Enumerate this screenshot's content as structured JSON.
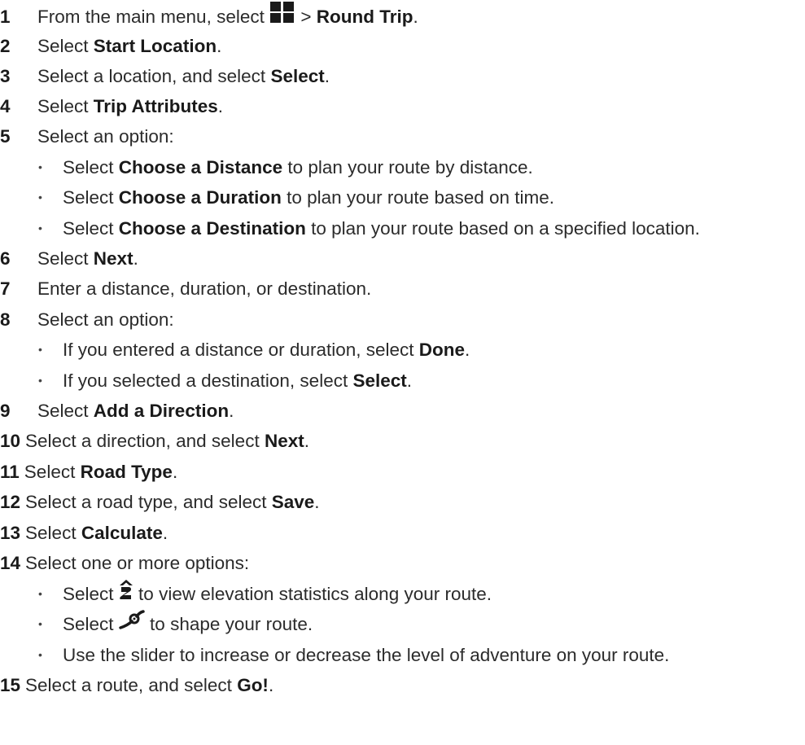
{
  "steps": [
    {
      "num": "1",
      "pre": "From the main menu, select",
      "mid": " > ",
      "bold": "Round Trip",
      "post": ".",
      "icon": "apps-grid-icon"
    },
    {
      "num": "2",
      "pre": "Select ",
      "bold": "Start Location",
      "post": "."
    },
    {
      "num": "3",
      "pre": "Select a location, and select ",
      "bold": "Select",
      "post": "."
    },
    {
      "num": "4",
      "pre": "Select ",
      "bold": "Trip Attributes",
      "post": "."
    },
    {
      "num": "5",
      "text": "Select an option:",
      "bullets": [
        {
          "pre": "Select ",
          "bold": "Choose a Distance",
          "post": " to plan your route by distance."
        },
        {
          "pre": "Select ",
          "bold": "Choose a Duration",
          "post": " to plan your route based on time."
        },
        {
          "pre": "Select ",
          "bold": "Choose a Destination",
          "post": " to plan your route based on a specified location."
        }
      ]
    },
    {
      "num": "6",
      "pre": "Select ",
      "bold": "Next",
      "post": "."
    },
    {
      "num": "7",
      "text": "Enter a distance, duration, or destination."
    },
    {
      "num": "8",
      "text": "Select an option:",
      "bullets": [
        {
          "pre": "If you entered a distance or duration, select ",
          "bold": "Done",
          "post": "."
        },
        {
          "pre": "If you selected a destination, select ",
          "bold": "Select",
          "post": "."
        }
      ]
    },
    {
      "num": "9",
      "pre": "Select ",
      "bold": "Add a Direction",
      "post": "."
    },
    {
      "num": "10",
      "pre": "Select a direction, and select ",
      "bold": "Next",
      "post": "."
    },
    {
      "num": "11",
      "pre": "Select ",
      "bold": "Road Type",
      "post": "."
    },
    {
      "num": "12",
      "pre": "Select a road type, and select ",
      "bold": "Save",
      "post": "."
    },
    {
      "num": "13",
      "pre": "Select ",
      "bold": "Calculate",
      "post": "."
    },
    {
      "num": "14",
      "text": "Select one or more options:",
      "bullets": [
        {
          "pre": "Select ",
          "post": " to view elevation statistics along your route.",
          "icon": "elevation-icon"
        },
        {
          "pre": "Select ",
          "post": " to shape your route.",
          "icon": "shape-route-icon"
        },
        {
          "text": "Use the slider to increase or decrease the level of adventure on your route."
        }
      ]
    },
    {
      "num": "15",
      "pre": "Select a route, and select ",
      "bold": "Go!",
      "post": "."
    }
  ],
  "bullet_char": "•",
  "colors": {
    "text": "#2b2b2b",
    "bold": "#1a1a1a",
    "icon": "#1a1a1a"
  }
}
